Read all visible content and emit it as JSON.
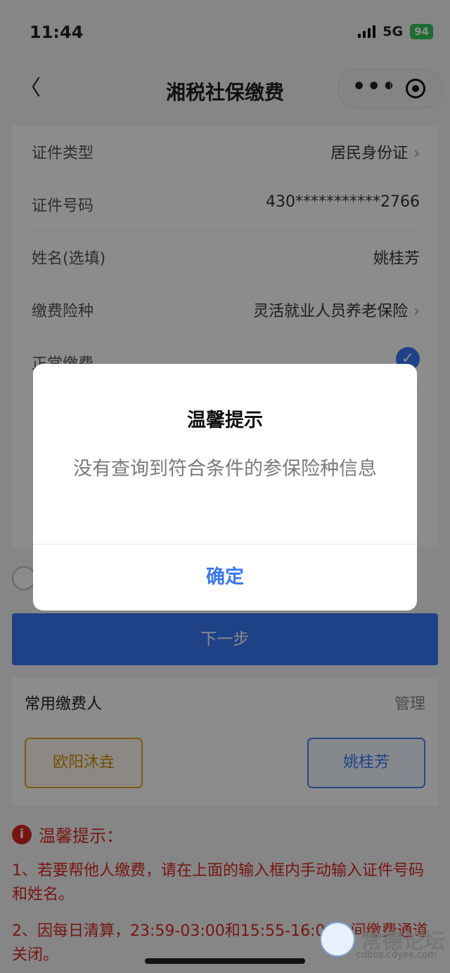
{
  "status_bar": {
    "time": "11:44",
    "network": "5G",
    "battery": "94"
  },
  "nav": {
    "back_symbol": "〈",
    "title": "湘税社保缴费",
    "more_symbol": "•••"
  },
  "form": {
    "rows": [
      {
        "label": "证件类型",
        "value": "居民身份证",
        "chevron": "›"
      },
      {
        "label": "证件号码",
        "value": "430***********2766"
      },
      {
        "label": "姓名(选填)",
        "value": "姚桂芳"
      },
      {
        "label": "缴费险种",
        "value": "灵活就业人员养老保险",
        "chevron": "›"
      },
      {
        "label": "正常缴费",
        "check": "✓"
      }
    ]
  },
  "next_button": "下一步",
  "payers": {
    "title": "常用缴费人",
    "manage": "管理",
    "names": [
      "欧阳沐垚",
      "姚桂芳"
    ]
  },
  "tips": {
    "icon": "i",
    "title": "温馨提示：",
    "items": [
      "1、若要帮他人缴费，请在上面的输入框内手动输入证件号码和姓名。",
      "2、因每日清算，23:59-03:00和15:55-16:00之间缴费通道关闭。"
    ]
  },
  "dialog": {
    "title": "温馨提示",
    "message": "没有查询到符合条件的参保险种信息",
    "confirm": "确定"
  },
  "watermark": {
    "text": "常德论坛",
    "sub": "cdbbs.cdyee.com"
  },
  "colors": {
    "accent": "#3a77f6",
    "warning": "#d9281f",
    "gold": "#e0a323"
  }
}
